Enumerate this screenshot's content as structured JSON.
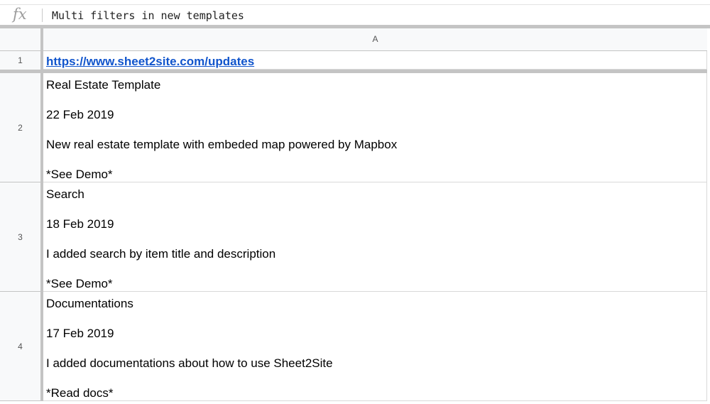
{
  "formula_bar": {
    "fx_label": "fx",
    "content": "Multi filters in new templates"
  },
  "grid": {
    "column_header": "A",
    "rows": [
      {
        "number": "1",
        "link": "https://www.sheet2site.com/updates"
      },
      {
        "number": "2",
        "lines": [
          "Real Estate Template",
          "22 Feb 2019",
          "New real estate template with embeded map powered by Mapbox",
          "*See Demo*"
        ]
      },
      {
        "number": "3",
        "lines": [
          "Search",
          "18 Feb 2019",
          "I added search by item title and description",
          "*See Demo*"
        ]
      },
      {
        "number": "4",
        "lines": [
          "Documentations",
          "17 Feb 2019",
          "I added documentations about how to use Sheet2Site",
          "*Read docs*"
        ]
      }
    ]
  },
  "colors": {
    "link": "#1155cc",
    "header_bg": "#f8f9fa",
    "grid_line": "#c4c4c4"
  }
}
